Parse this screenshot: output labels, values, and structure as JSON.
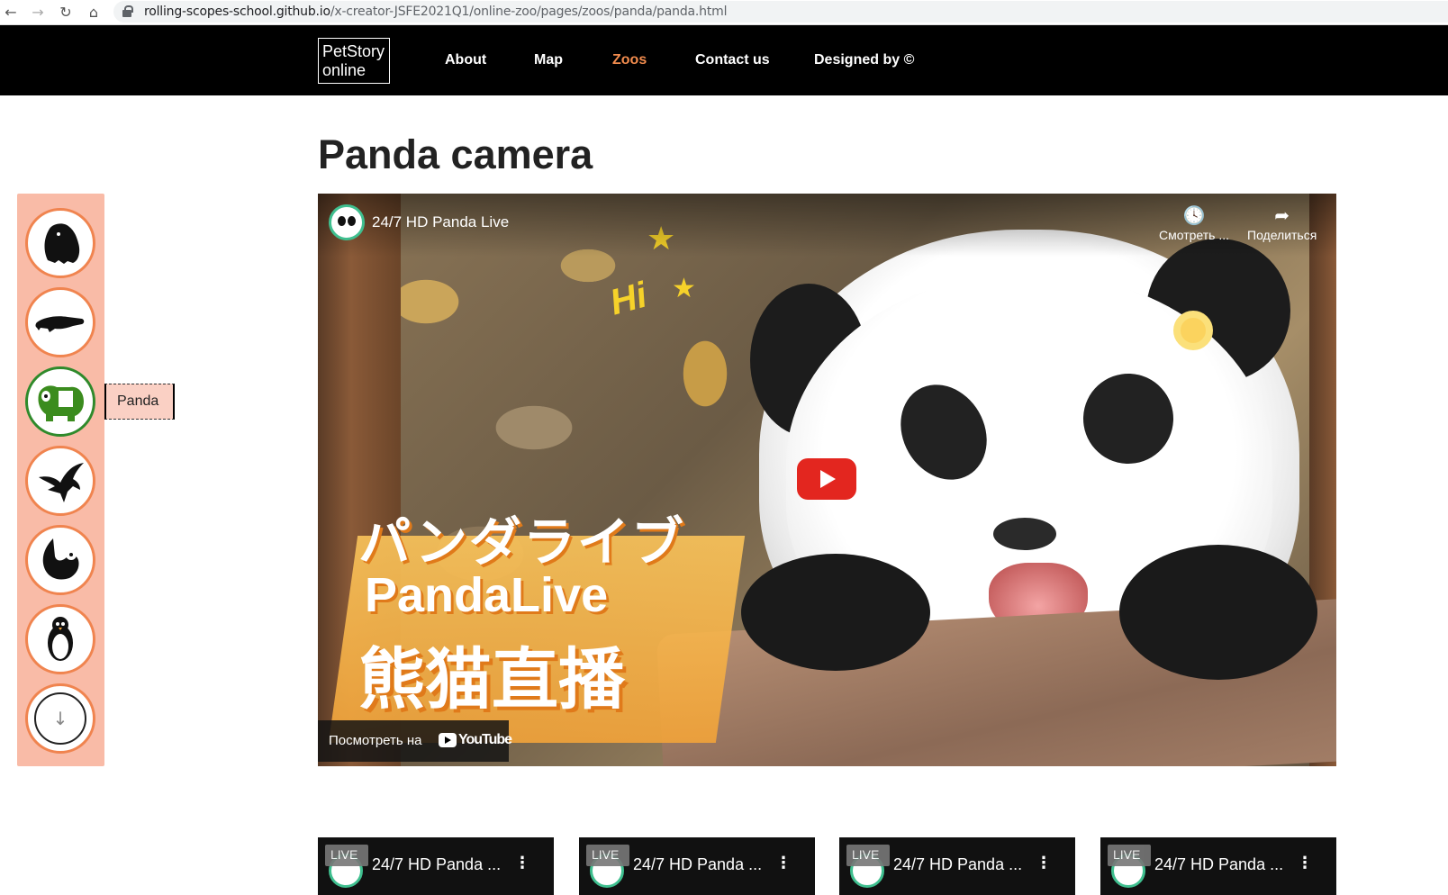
{
  "browser": {
    "url_host": "rolling-scopes-school.github.io",
    "url_path": "/x-creator-JSFE2021Q1/online-zoo/pages/zoos/panda/panda.html",
    "back_icon": "arrow-left-icon",
    "forward_icon": "arrow-right-icon",
    "reload_icon": "reload-icon",
    "home_icon": "home-icon"
  },
  "header": {
    "logo_line1": "PetStory",
    "logo_line2": "online",
    "menu": [
      "About",
      "Map",
      "Zoos",
      "Contact us",
      "Designed by ©"
    ],
    "active_item": "Zoos",
    "active_color": "#f28c4e"
  },
  "page": {
    "title": "Panda camera"
  },
  "sidebar": {
    "background": "#f9bba7",
    "items": [
      {
        "icon": "gorilla-icon"
      },
      {
        "icon": "alligator-icon"
      },
      {
        "icon": "panda-icon",
        "active": true
      },
      {
        "icon": "eagle-icon"
      },
      {
        "icon": "sloth-icon"
      },
      {
        "icon": "penguin-icon"
      }
    ],
    "scroll_down_symbol": "↓",
    "tooltip": "Panda"
  },
  "video": {
    "channel_title": "24/7 HD Panda Live",
    "watch_later": "Смотреть ...",
    "share": "Поделиться",
    "overlay_jp": "パンダライブ",
    "overlay_en": "PandaLive",
    "overlay_cn": "熊猫直播",
    "overlay_hi": "Hi",
    "watch_on": "Посмотреть на",
    "youtube": "YouTube"
  },
  "thumbnails": [
    {
      "live": "LIVE",
      "title": "24/7 HD Panda ..."
    },
    {
      "live": "LIVE",
      "title": "24/7 HD Panda ..."
    },
    {
      "live": "LIVE",
      "title": "24/7 HD Panda ..."
    },
    {
      "live": "LIVE",
      "title": "24/7 HD Panda ..."
    }
  ]
}
